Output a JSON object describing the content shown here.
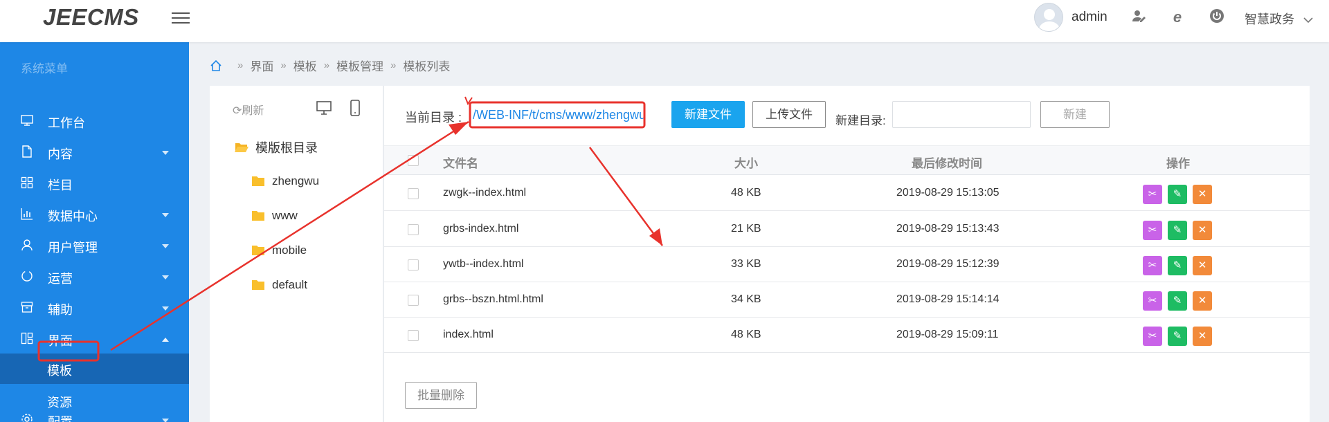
{
  "header": {
    "logo": "JEECMS",
    "username": "admin",
    "site_name": "智慧政务",
    "icons": [
      "menu-icon",
      "user-edit-icon",
      "ie-icon",
      "power-icon",
      "chevron-down-icon"
    ]
  },
  "sidebar": {
    "title": "系统菜单",
    "items": [
      {
        "label": "工作台",
        "icon": "monitor-icon"
      },
      {
        "label": "内容",
        "icon": "document-icon"
      },
      {
        "label": "栏目",
        "icon": "grid-icon"
      },
      {
        "label": "数据中心",
        "icon": "bar-chart-icon"
      },
      {
        "label": "用户管理",
        "icon": "user-icon"
      },
      {
        "label": "运营",
        "icon": "refresh-circle-icon"
      },
      {
        "label": "辅助",
        "icon": "archive-icon"
      },
      {
        "label": "界面",
        "icon": "layout-icon"
      },
      {
        "label": "配置",
        "icon": "settings-icon"
      }
    ],
    "sub_items": [
      {
        "label": "模板"
      },
      {
        "label": "资源"
      }
    ]
  },
  "breadcrumb": {
    "items": [
      "界面",
      "模板",
      "模板管理",
      "模板列表"
    ]
  },
  "tree": {
    "refresh_label": "刷新",
    "root": "模版根目录",
    "nodes": [
      "zhengwu",
      "www",
      "mobile",
      "default"
    ]
  },
  "toolbar": {
    "current_dir_label": "当前目录 :",
    "current_dir_value": "/WEB-INF/t/cms/www/zhengwu",
    "new_file_label": "新建文件",
    "upload_label": "上传文件",
    "new_dir_label": "新建目录:",
    "new_dir_placeholder": "",
    "create_label": "新建"
  },
  "table": {
    "columns": [
      "文件名",
      "大小",
      "最后修改时间",
      "操作"
    ],
    "rows": [
      {
        "name": "zwgk--index.html",
        "size": "48 KB",
        "modified": "2019-08-29 15:13:05"
      },
      {
        "name": "grbs-index.html",
        "size": "21 KB",
        "modified": "2019-08-29 15:13:43"
      },
      {
        "name": "ywtb--index.html",
        "size": "33 KB",
        "modified": "2019-08-29 15:12:39"
      },
      {
        "name": "grbs--bszn.html.html",
        "size": "34 KB",
        "modified": "2019-08-29 15:14:14"
      },
      {
        "name": "index.html",
        "size": "48 KB",
        "modified": "2019-08-29 15:09:11"
      }
    ],
    "batch_delete_label": "批量删除"
  },
  "colors": {
    "sidebar": "#1e87e6",
    "sidebar_active": "#1766b4",
    "primary": "#1aa4ee",
    "annotation": "#e8322c"
  }
}
